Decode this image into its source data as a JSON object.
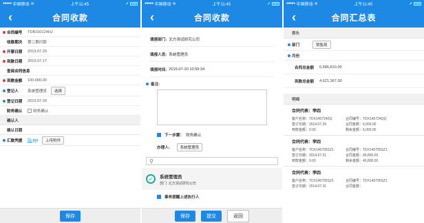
{
  "status": {
    "carrier": "中国移动",
    "time": "上午11:45"
  },
  "screen1": {
    "title": "合同收款",
    "rows": [
      {
        "label": "合同编号",
        "value": "TDB150124HJ",
        "dot": "red"
      },
      {
        "label": "收款期次",
        "value": "第二期付款",
        "dot": "none"
      },
      {
        "label": "开票日期",
        "value": "2015.07.20",
        "dot": "red"
      },
      {
        "label": "到款日期",
        "value": "2015.07.17",
        "dot": "red"
      },
      {
        "label": "查阅合同信息",
        "value": "",
        "dot": "none"
      },
      {
        "label": "到款金额",
        "value": "100,000.00",
        "dot": "red"
      }
    ],
    "registrar_label": "登记人",
    "registrar_value": "系统管理员",
    "select_button": "选择",
    "register_date_label": "登记日期",
    "register_date_value": "2015.07.20",
    "finance_confirm_label": "财务确认",
    "finance_confirm_checkbox": "财务确认",
    "confirmer_label": "确认人",
    "confirm_date_label": "确认日期",
    "remit_label": "汇款凭据",
    "remit_file": "01.jpg",
    "upload_button": "上传附件",
    "save_button": "保存"
  },
  "screen2": {
    "title": "合同收款",
    "dept_label": "填报部门:",
    "dept_value": "北方测试研究公司",
    "reporter_label": "填报人员:",
    "reporter_value": "系统管理员",
    "time_label": "填报时间:",
    "time_value": "2015-07-20 10:59:34",
    "remark_label": "备注:",
    "next_step_label": "下一步骤：",
    "next_step_value": "财务确认",
    "handler_label": "办理人:",
    "handler_value": "系统管理员",
    "user_name": "系统管理员",
    "user_dept_label": "部门:",
    "user_dept_value": "北方测试研究公司",
    "remind_label": "事务提醒上述执行人",
    "save_button": "保存",
    "submit_button": "提交",
    "back_button": "返回"
  },
  "screen3": {
    "title": "合同汇总表",
    "header_group": "表头",
    "dept_label": "部门",
    "dept_button": "销售局",
    "month_label": "月份",
    "total_label": "合同总金额",
    "total_value": "6,586,810.00",
    "received_label": "到款总金额",
    "received_value": "4,621,367.00",
    "detail_group": "明细",
    "cards": [
      {
        "title": "合同代表：李四",
        "customer": "客户名称：TDX1407240Q",
        "contract_no": "合同编号：TDX140724QQ",
        "sign_date": "签订日期：2014.07.29",
        "amount": "合同金额：6,000.00",
        "received": "到款金额：0.00",
        "remain": "剩余金额：6,000.00"
      },
      {
        "title": "合同代表：李四",
        "customer": "客户名称：TDX140705SZ1",
        "contract_no": "合同编号：TDX140705SZ1",
        "sign_date": "签订日期：2014.07.31",
        "amount": "合同金额：49,800.00",
        "received": "到款金额：0.00",
        "remain": "剩余金额：49,800.00"
      },
      {
        "title": "合同代表：李四",
        "customer": "客户名称：TDX140705SZ1",
        "contract_no": "合同编号：TDX140705SZ1",
        "sign_date": "签订日期：2014.07.31",
        "amount": "合同金额：",
        "received": "",
        "remain": ""
      }
    ]
  },
  "colors": {
    "primary": "#1e88e5",
    "required": "#e53935",
    "check": "#22aa99"
  }
}
